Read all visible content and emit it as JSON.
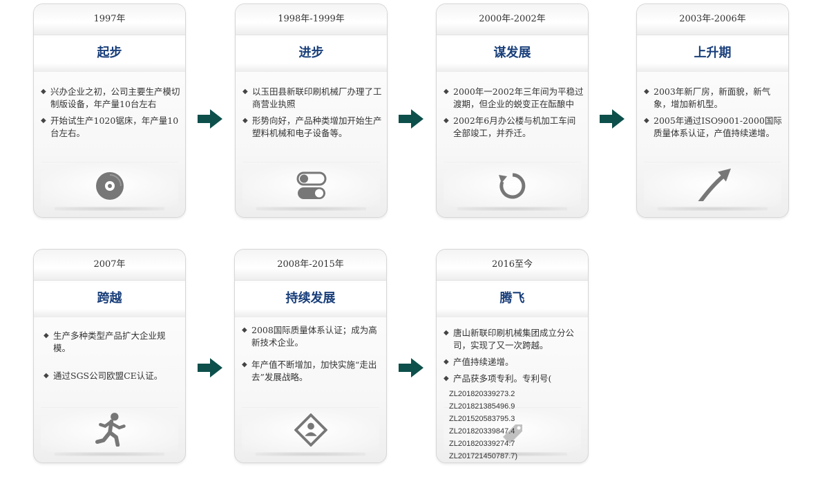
{
  "timeline": [
    {
      "year": "1997年",
      "title": "起步",
      "items": [
        "兴办企业之初，公司主要生产模切制版设备，年产量10台左右",
        "开始试生产1020锯床，年产量10台左右。"
      ],
      "icon": "disc-icon"
    },
    {
      "year": "1998年-1999年",
      "title": "进步",
      "items": [
        "以玉田县新联印刷机械厂办理了工商营业执照",
        "形势向好，产品种类增加开始生产塑料机械和电子设备等。"
      ],
      "icon": "toggle-switch-icon"
    },
    {
      "year": "2000年-2002年",
      "title": "谋发展",
      "items": [
        "2000年一2002年三年间为平稳过渡期，但企业的蜕变正在酝酿中",
        "2002年6月办公楼与机加工车间全部竣工，并乔迁。"
      ],
      "icon": "refresh-icon"
    },
    {
      "year": "2003年-2006年",
      "title": "上升期",
      "items": [
        "2003年新厂房，新面貌，新气象，增加新机型。",
        "2005年通过ISO9001-2000国际质量体系认证，产值持续递增。"
      ],
      "icon": "rising-arrow-icon"
    },
    {
      "year": "2007年",
      "title": "跨越",
      "items": [
        "生产多种类型产品扩大企业规模。",
        "通过SGS公司欧盟CE认证。"
      ],
      "icon": "running-man-icon"
    },
    {
      "year": "2008年-2015年",
      "title": "持续发展",
      "items": [
        "2008国际质量体系认证；成为高新技术企业。",
        "年产值不断增加，加快实施“走出去”发展战略。"
      ],
      "icon": "diamond-person-icon"
    },
    {
      "year": "2016至今",
      "title": "腾飞",
      "items": [
        "唐山新联印刷机械集团成立分公司，实现了又一次跨越。",
        "产值持续递增。",
        "产品获多项专利。专利号("
      ],
      "patents": [
        "ZL201820339273.2",
        "ZL201821385496.9",
        "ZL201520583795.3",
        "ZL201820339847.4",
        "ZL201820339274.7",
        "ZL201721450787.7)"
      ],
      "icon": "tag-icon"
    }
  ],
  "colors": {
    "title": "#183e7a",
    "arrow": "#0d4f4b",
    "icon": "#777777"
  }
}
